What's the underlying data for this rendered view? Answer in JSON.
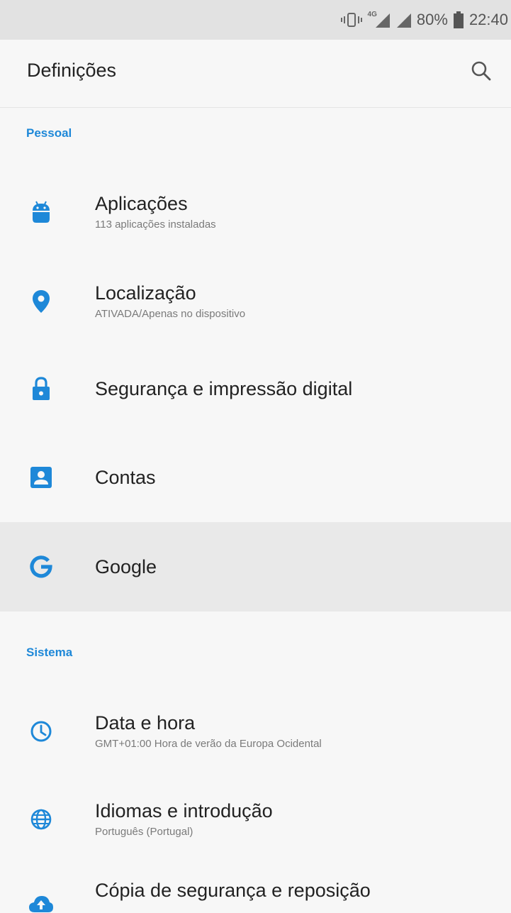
{
  "status_bar": {
    "battery": "80%",
    "time": "22:40",
    "network_label": "4G",
    "icons": [
      "vibrate-icon",
      "mobile-data-icon",
      "signal-icon",
      "battery-icon"
    ]
  },
  "app_bar": {
    "title": "Definições",
    "search_icon": "search-icon"
  },
  "sections": {
    "personal": {
      "header": "Pessoal",
      "items": [
        {
          "title": "Aplicações",
          "subtitle": "113 aplicações instaladas",
          "icon": "android-icon"
        },
        {
          "title": "Localização",
          "subtitle": "ATIVADA/Apenas no dispositivo",
          "icon": "location-pin-icon"
        },
        {
          "title": "Segurança e impressão digital",
          "icon": "lock-icon"
        },
        {
          "title": "Contas",
          "icon": "account-box-icon"
        },
        {
          "title": "Google",
          "icon": "google-icon",
          "highlighted": true
        }
      ]
    },
    "system": {
      "header": "Sistema",
      "items": [
        {
          "title": "Data e hora",
          "subtitle": "GMT+01:00 Hora de verão da Europa Ocidental",
          "icon": "clock-icon"
        },
        {
          "title": "Idiomas e introdução",
          "subtitle": "Português (Portugal)",
          "icon": "globe-icon"
        },
        {
          "title": "Cópia de segurança e reposição",
          "icon": "cloud-upload-icon"
        }
      ]
    }
  },
  "colors": {
    "accent": "#1e88d8",
    "background": "#f7f7f7",
    "status_bar": "#e2e2e2",
    "highlight": "#e9e9e9"
  }
}
